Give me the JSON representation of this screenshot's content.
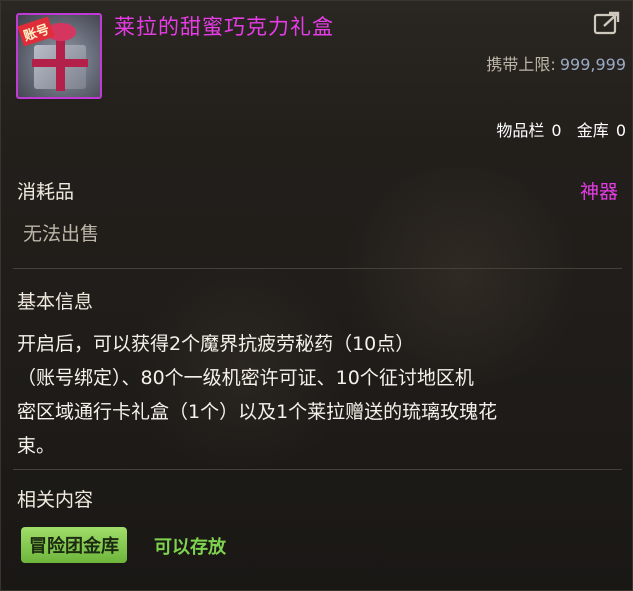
{
  "item": {
    "icon_name": "gift-box-icon",
    "icon_tag": "账号",
    "name": "莱拉的甜蜜巧克力礼盒",
    "name_color": "#e63ce6",
    "carry_limit_label": "携带上限:",
    "carry_limit_value": "999,999",
    "inventory_label": "物品栏",
    "inventory_count": "0",
    "vault_label": "金库",
    "vault_count": "0"
  },
  "info": {
    "category": "消耗品",
    "rarity": "神器",
    "rarity_color": "#e63ce6",
    "sell_status": "无法出售"
  },
  "basic_info": {
    "title": "基本信息",
    "description": "开启后，可以获得2个魔界抗疲劳秘药（10点）\n（账号绑定）、80个一级机密许可证、10个征讨地区机\n密区域通行卡礼盒（1个）以及1个莱拉赠送的琉璃玫瑰花\n束。"
  },
  "related": {
    "title": "相关内容",
    "badge_label": "冒险团金库",
    "badge_color": "#8fd45a",
    "note": "可以存放"
  },
  "share_icon_name": "share-icon"
}
